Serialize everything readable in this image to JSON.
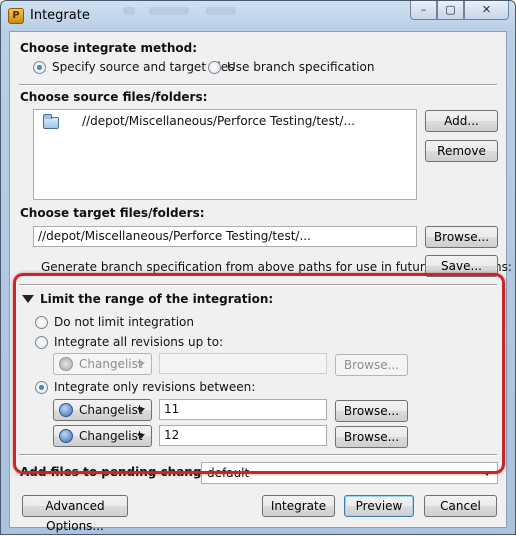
{
  "window": {
    "title": "Integrate",
    "icon": "p4-app-icon",
    "caption": {
      "minimize": "–",
      "maximize": "▢",
      "close": "✕"
    }
  },
  "method": {
    "title": "Choose integrate method:",
    "option_specify": "Specify source and target files",
    "option_branch": "Use branch specification",
    "selected": "specify"
  },
  "source": {
    "title": "Choose source files/folders:",
    "items": [
      "//depot/Miscellaneous/Perforce Testing/test/..."
    ],
    "add_label": "Add...",
    "remove_label": "Remove"
  },
  "target": {
    "title": "Choose target files/folders:",
    "path": "//depot/Miscellaneous/Perforce Testing/test/...",
    "browse_label": "Browse...",
    "generate_text": "Generate branch specification from above paths for use in future integrations:",
    "save_label": "Save..."
  },
  "range": {
    "title": "Limit the range of the integration:",
    "option_none": "Do not limit integration",
    "option_upto": "Integrate all revisions up to:",
    "option_between": "Integrate only revisions between:",
    "selected": "between",
    "upto_type": "Changelist",
    "upto_value": "",
    "browse_label": "Browse...",
    "between_from_type": "Changelist",
    "between_from_value": "11",
    "between_to_type": "Changelist",
    "between_to_value": "12"
  },
  "pending": {
    "label": "Add files to pending changelist:",
    "value": "default"
  },
  "footer": {
    "advanced_label": "Advanced Options...",
    "integrate_label": "Integrate",
    "preview_label": "Preview",
    "cancel_label": "Cancel"
  },
  "colors": {
    "highlight": "#c62828",
    "accent": "#3c7fb1"
  }
}
